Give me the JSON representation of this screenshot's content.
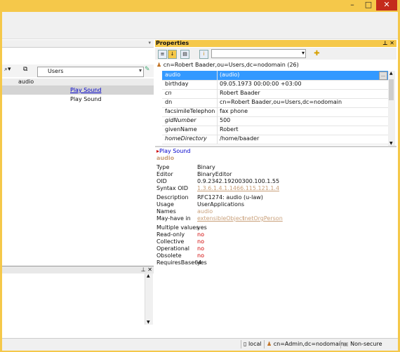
{
  "window": {
    "minimize_glyph": "–",
    "maximize_glyph": "□",
    "close_glyph": "✕"
  },
  "left_pane": {
    "filter_combo_value": "Users",
    "column_header": "audio",
    "rows": [
      {
        "value": "Play Sound"
      },
      {
        "value": "Play Sound"
      }
    ]
  },
  "properties": {
    "title": "Properties",
    "dn_header": "cn=Robert Baader,ou=Users,dc=nodomain (26)",
    "grid": [
      {
        "name": "audio",
        "value": "(audio)"
      },
      {
        "name": "birthday",
        "value": "09.05.1973 00:00:00 +03:00"
      },
      {
        "name": "cn",
        "value": "Robert Baader"
      },
      {
        "name": "dn",
        "value": "cn=Robert Baader,ou=Users,dc=nodomain"
      },
      {
        "name": "facsimileTelephon...",
        "value": "fax phone"
      },
      {
        "name": "gidNumber",
        "value": "500"
      },
      {
        "name": "givenName",
        "value": "Robert"
      },
      {
        "name": "homeDirectory",
        "value": "/home/baader"
      }
    ],
    "play_sound": "Play Sound",
    "schema": {
      "attr_name": "audio",
      "type_label": "Type",
      "type_value": "Binary",
      "editor_label": "Editor",
      "editor_value": "BinaryEditor",
      "oid_label": "OID",
      "oid_value": "0.9.2342.19200300.100.1.55",
      "syntax_label": "Syntax OID",
      "syntax_value": "1.3.6.1.4.1.1466.115.121.1.4",
      "desc_label": "Description",
      "desc_value": "RFC1274: audio (u-law)",
      "usage_label": "Usage",
      "usage_value": "UserApplications",
      "names_label": "Names",
      "names_value": "audio",
      "mayhave_label": "May-have in",
      "mayhave_1": "extensibleObject",
      "mayhave_2": "inetOrgPerson",
      "multi_label": "Multiple values",
      "multi_value": "yes",
      "readonly_label": "Read-only",
      "readonly_value": "no",
      "collective_label": "Collective",
      "collective_value": "no",
      "operational_label": "Operational",
      "operational_value": "no",
      "obsolete_label": "Obsolete",
      "obsolete_value": "no",
      "requiresb64_label": "RequiresBase64",
      "requiresb64_value": "yes"
    }
  },
  "status": {
    "local": "local",
    "user": "cn=Admin,dc=nodomain",
    "security": "Non-secure"
  }
}
